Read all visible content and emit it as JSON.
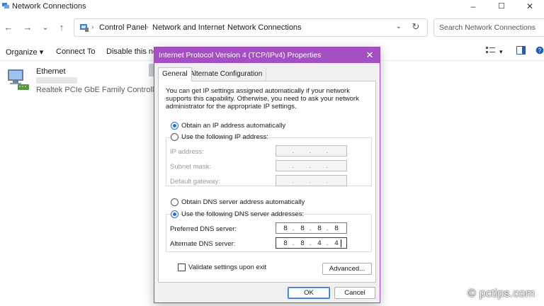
{
  "window": {
    "title": "Network Connections",
    "minimize": "–",
    "maximize": "☐",
    "close": "✕"
  },
  "nav": {
    "back": "←",
    "forward": "→",
    "recent": "⌄",
    "up": "↑"
  },
  "address": {
    "crumbs": [
      "Control Panel",
      "Network and Internet",
      "Network Connections"
    ],
    "separator": "›",
    "dropdown": "⌄",
    "refresh": "↻"
  },
  "search": {
    "placeholder": "Search Network Connections"
  },
  "commandbar": {
    "organize": "Organize ▾",
    "connect_to": "Connect To",
    "disable": "Disable this net",
    "view_menu": "▾"
  },
  "connections": [
    {
      "name": "Ethernet",
      "device": "Realtek PCIe GbE Family Controller"
    }
  ],
  "dialog": {
    "title": "Internet Protocol Version 4 (TCP/IPv4) Properties",
    "close": "✕",
    "tabs": [
      "General",
      "Alternate Configuration"
    ],
    "intro": "You can get IP settings assigned automatically if your network supports this capability. Otherwise, you need to ask your network administrator for the appropriate IP settings.",
    "ip_auto_label": "Obtain an IP address automatically",
    "ip_manual_label": "Use the following IP address:",
    "ip_fields": {
      "ip_address": "IP address:",
      "subnet_mask": "Subnet mask:",
      "default_gateway": "Default gateway:"
    },
    "dns_auto_label": "Obtain DNS server address automatically",
    "dns_manual_label": "Use the following DNS server addresses:",
    "preferred_dns_label": "Preferred DNS server:",
    "alternate_dns_label": "Alternate DNS server:",
    "preferred_dns": [
      "8",
      "8",
      "8",
      "8"
    ],
    "alternate_dns": [
      "8",
      "8",
      "4",
      "4"
    ],
    "dot": ".",
    "validate_label": "Validate settings upon exit",
    "advanced": "Advanced...",
    "ok": "OK",
    "cancel": "Cancel",
    "state": {
      "ip_mode": "automatic",
      "dns_mode": "manual",
      "validate_checked": false
    }
  },
  "watermark": "© pctips.com",
  "colors": {
    "dialog_title_bar": "#a44fc2",
    "radio_selected": "#2a6fd6"
  }
}
